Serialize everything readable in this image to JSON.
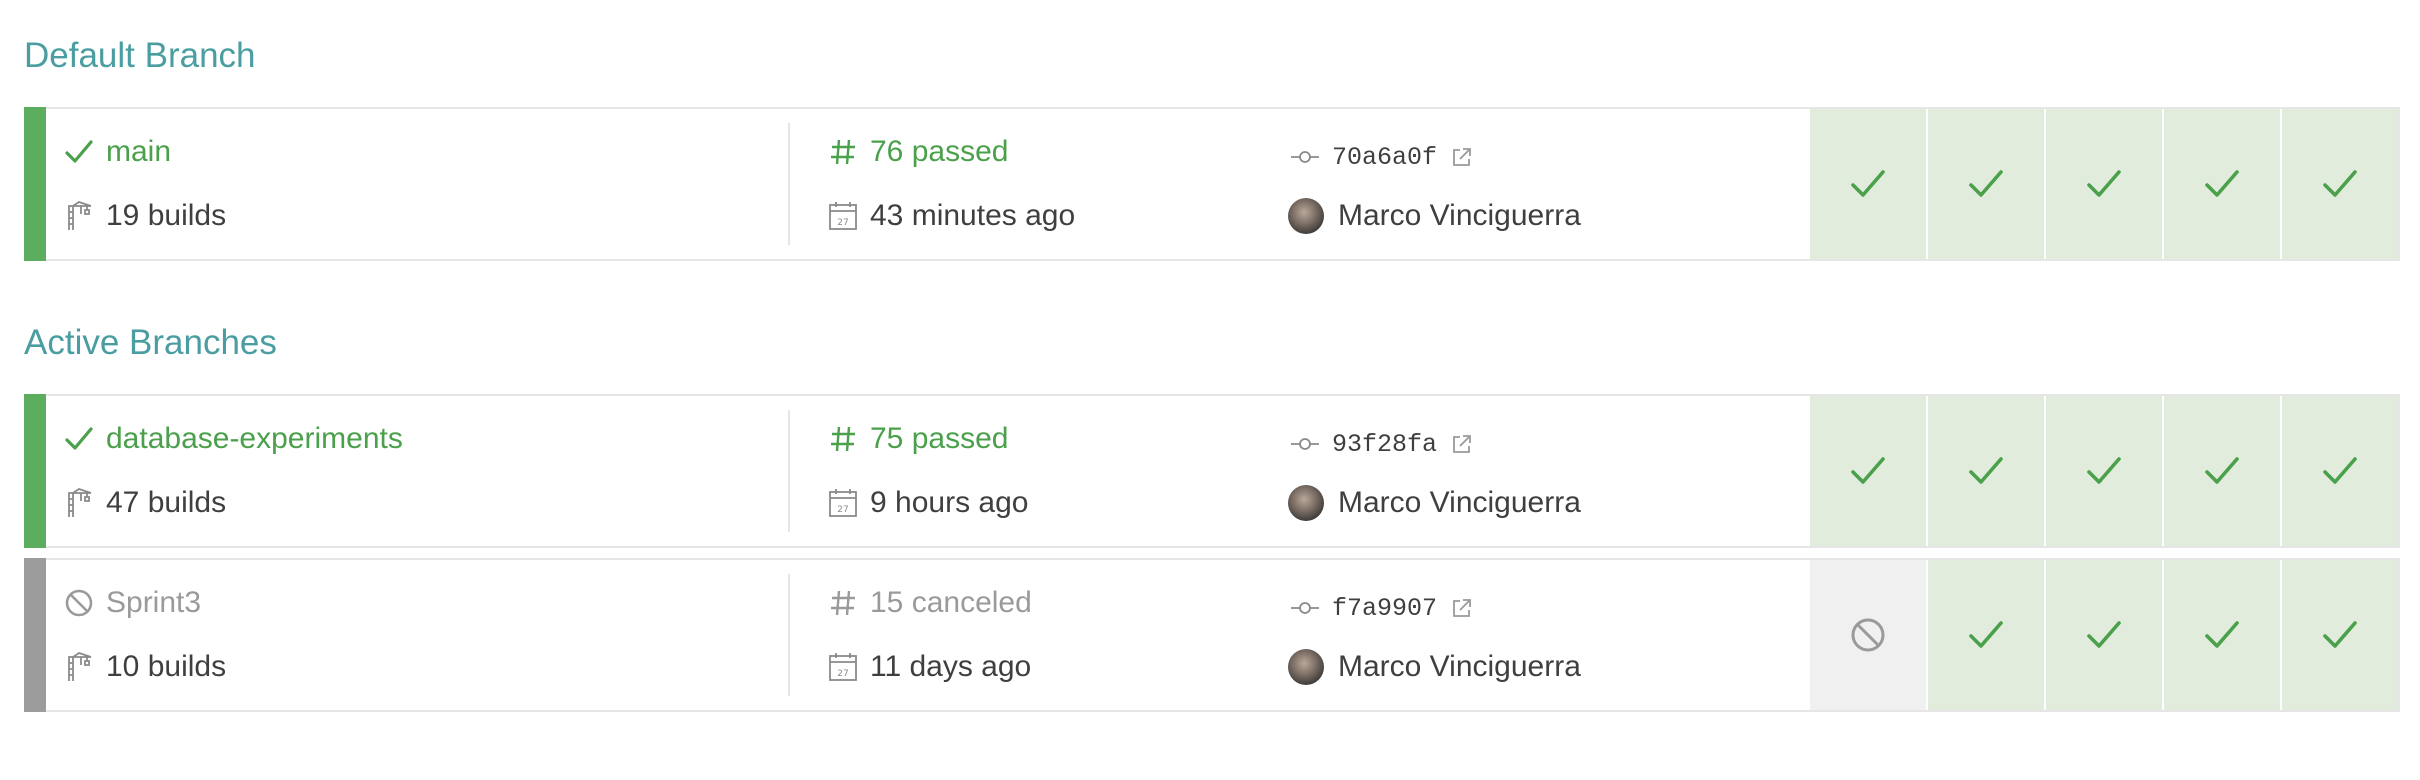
{
  "colors": {
    "section_title": "#4a9ea1",
    "passed": "#5cad5d",
    "passed_text": "#4aa04b",
    "canceled": "#9c9c9c",
    "passed_box": "#e1ecdc",
    "canceled_box": "#f0f0f0"
  },
  "default_section": {
    "title": "Default Branch",
    "row": {
      "status": "passed",
      "status_icon": "check-icon",
      "branch_name": "main",
      "builds": "19 builds",
      "last_build": "76 passed",
      "when": "43 minutes ago",
      "commit": "70a6a0f",
      "author": "Marco Vinciguerra",
      "history": [
        "passed",
        "passed",
        "passed",
        "passed",
        "passed"
      ]
    }
  },
  "active_section": {
    "title": "Active Branches",
    "rows": [
      {
        "status": "passed",
        "status_icon": "check-icon",
        "branch_name": "database-experiments",
        "builds": "47 builds",
        "last_build": "75 passed",
        "when": "9 hours ago",
        "commit": "93f28fa",
        "author": "Marco Vinciguerra",
        "history": [
          "passed",
          "passed",
          "passed",
          "passed",
          "passed"
        ]
      },
      {
        "status": "canceled",
        "status_icon": "canceled-icon",
        "branch_name": "Sprint3",
        "builds": "10 builds",
        "last_build": "15 canceled",
        "when": "11 days ago",
        "commit": "f7a9907",
        "author": "Marco Vinciguerra",
        "history": [
          "canceled",
          "passed",
          "passed",
          "passed",
          "passed"
        ]
      }
    ]
  }
}
